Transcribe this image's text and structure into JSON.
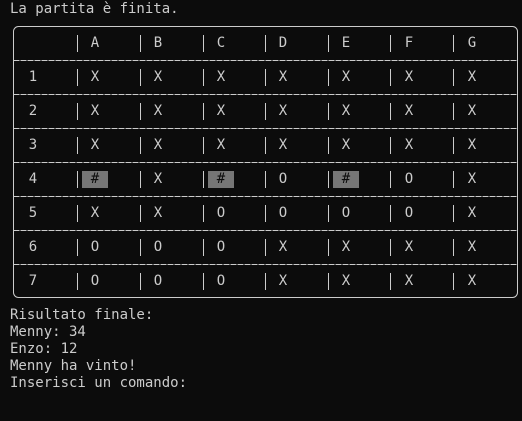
{
  "terminal": {
    "status_line": "La partita è finita.",
    "result_header": "Risultato finale:",
    "score_menny": "Menny: 34",
    "score_enzo": "Enzo: 12",
    "winner_line": "Menny ha vinto!",
    "prompt": "Inserisci un comando:"
  },
  "board": {
    "columns": [
      "A",
      "B",
      "C",
      "D",
      "E",
      "F",
      "G"
    ],
    "rows": [
      {
        "label": "1",
        "cells": [
          "X",
          "X",
          "X",
          "X",
          "X",
          "X",
          "X"
        ]
      },
      {
        "label": "2",
        "cells": [
          "X",
          "X",
          "X",
          "X",
          "X",
          "X",
          "X"
        ]
      },
      {
        "label": "3",
        "cells": [
          "X",
          "X",
          "X",
          "X",
          "X",
          "X",
          "X"
        ]
      },
      {
        "label": "4",
        "cells": [
          "#",
          "X",
          "#",
          "O",
          "#",
          "O",
          "X"
        ]
      },
      {
        "label": "5",
        "cells": [
          "X",
          "X",
          "O",
          "O",
          "O",
          "O",
          "X"
        ]
      },
      {
        "label": "6",
        "cells": [
          "O",
          "O",
          "O",
          "X",
          "X",
          "X",
          "X"
        ]
      },
      {
        "label": "7",
        "cells": [
          "O",
          "O",
          "O",
          "X",
          "X",
          "X",
          "X"
        ]
      }
    ],
    "hidden_symbol": "#",
    "colors": {
      "text": "#cccccc",
      "background": "#0c0c0c",
      "hidden_cell": "#767676"
    }
  }
}
